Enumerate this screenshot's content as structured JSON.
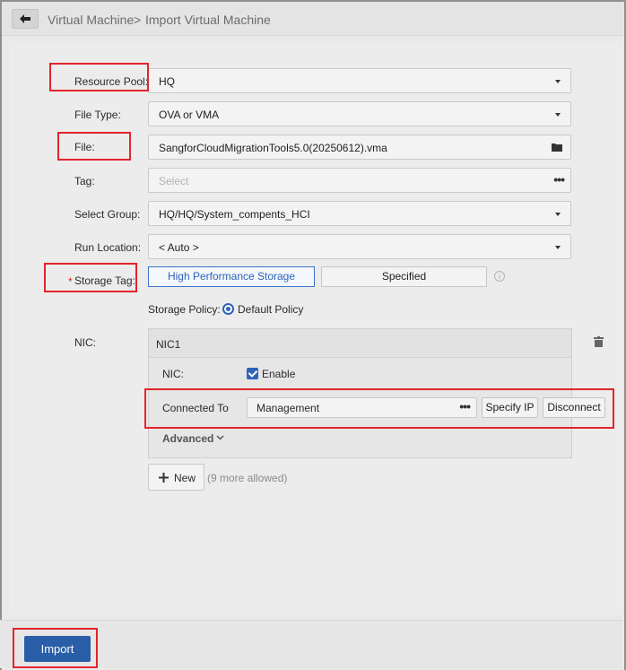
{
  "breadcrumb": {
    "parent": "Virtual Machine",
    "separator": ">",
    "current": "Import Virtual Machine"
  },
  "form": {
    "resource_pool": {
      "label": "Resource Pool:",
      "value": "HQ"
    },
    "file_type": {
      "label": "File Type:",
      "value": "OVA or VMA"
    },
    "file": {
      "label": "File:",
      "value": "SangforCloudMigrationTools5.0(20250612).vma"
    },
    "tag": {
      "label": "Tag:",
      "placeholder": "Select"
    },
    "select_group": {
      "label": "Select Group:",
      "value": "HQ/HQ/System_compents_HCI"
    },
    "run_location": {
      "label": "Run Location:",
      "value": "< Auto >"
    },
    "storage_tag": {
      "required_mark": "*",
      "label": "Storage Tag:",
      "options": [
        "High Performance Storage",
        "Specified"
      ],
      "selected": "High Performance Storage"
    },
    "storage_policy": {
      "label": "Storage Policy:",
      "value": "Default Policy"
    },
    "nic": {
      "label": "NIC:",
      "panel_title": "NIC1",
      "enable_label": "NIC:",
      "enable_text": "Enable",
      "enabled": true,
      "connected_to_label": "Connected To",
      "connected_to_value": "Management",
      "specify_ip_label": "Specify IP",
      "disconnect_label": "Disconnect",
      "advanced_label": "Advanced"
    },
    "new_button": {
      "label": "New",
      "hint": "(9 more allowed)"
    }
  },
  "footer": {
    "import_label": "Import"
  },
  "colors": {
    "accent": "#2a5ea8",
    "highlight": "#e3242b"
  }
}
